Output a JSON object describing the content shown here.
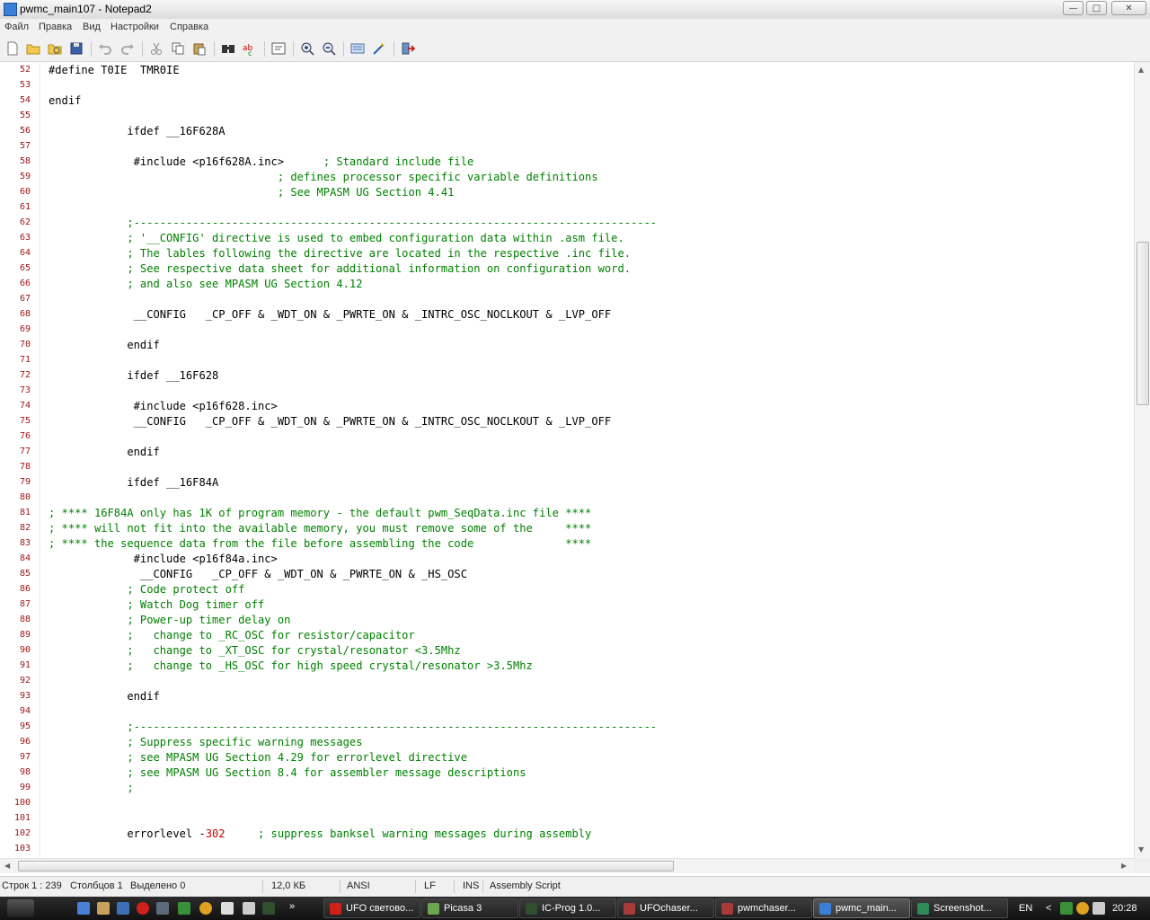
{
  "window": {
    "title": "pwmc_main107 - Notepad2"
  },
  "window_controls": {
    "minimize": "—",
    "maximize": "□",
    "close": "✕"
  },
  "menu": {
    "items": [
      "Файл",
      "Правка",
      "Вид",
      "Настройки",
      "Справка"
    ]
  },
  "toolbar": {
    "icons": [
      "new-file-icon",
      "open-file-icon",
      "browse-icon",
      "save-icon",
      "undo-icon",
      "redo-icon",
      "cut-icon",
      "copy-icon",
      "paste-icon",
      "find-icon",
      "replace-icon",
      "wrap-icon",
      "zoom-in-icon",
      "zoom-out-icon",
      "select-all-icon",
      "settings-icon",
      "exit-icon"
    ]
  },
  "editor": {
    "lines": [
      {
        "n": "52",
        "t": "#define T0IE  TMR0IE",
        "c": ""
      },
      {
        "n": "53",
        "t": "",
        "c": ""
      },
      {
        "n": "54",
        "t": "endif",
        "c": ""
      },
      {
        "n": "55",
        "t": "",
        "c": ""
      },
      {
        "n": "56",
        "t": "            ifdef __16F628A",
        "c": ""
      },
      {
        "n": "57",
        "t": "",
        "c": ""
      },
      {
        "n": "58",
        "t": "             #include <p16f628A.inc>      ",
        "c": "; Standard include file"
      },
      {
        "n": "59",
        "t": "                                   ",
        "c": "; defines processor specific variable definitions"
      },
      {
        "n": "60",
        "t": "                                   ",
        "c": "; See MPASM UG Section 4.41"
      },
      {
        "n": "61",
        "t": "",
        "c": ""
      },
      {
        "n": "62",
        "t": "            ",
        "c": ";--------------------------------------------------------------------------------"
      },
      {
        "n": "63",
        "t": "            ",
        "c": "; '__CONFIG' directive is used to embed configuration data within .asm file."
      },
      {
        "n": "64",
        "t": "            ",
        "c": "; The lables following the directive are located in the respective .inc file."
      },
      {
        "n": "65",
        "t": "            ",
        "c": "; See respective data sheet for additional information on configuration word."
      },
      {
        "n": "66",
        "t": "            ",
        "c": "; and also see MPASM UG Section 4.12"
      },
      {
        "n": "67",
        "t": "",
        "c": ""
      },
      {
        "n": "68",
        "t": "             __CONFIG   _CP_OFF & _WDT_ON & _PWRTE_ON & _INTRC_OSC_NOCLKOUT & _LVP_OFF",
        "c": ""
      },
      {
        "n": "69",
        "t": "",
        "c": ""
      },
      {
        "n": "70",
        "t": "            endif",
        "c": ""
      },
      {
        "n": "71",
        "t": "",
        "c": ""
      },
      {
        "n": "72",
        "t": "            ifdef __16F628",
        "c": ""
      },
      {
        "n": "73",
        "t": "",
        "c": ""
      },
      {
        "n": "74",
        "t": "             #include <p16f628.inc>",
        "c": ""
      },
      {
        "n": "75",
        "t": "             __CONFIG   _CP_OFF & _WDT_ON & _PWRTE_ON & _INTRC_OSC_NOCLKOUT & _LVP_OFF",
        "c": ""
      },
      {
        "n": "76",
        "t": "",
        "c": ""
      },
      {
        "n": "77",
        "t": "            endif",
        "c": ""
      },
      {
        "n": "78",
        "t": "",
        "c": ""
      },
      {
        "n": "79",
        "t": "            ifdef __16F84A",
        "c": ""
      },
      {
        "n": "80",
        "t": "",
        "c": ""
      },
      {
        "n": "81",
        "t": "",
        "c": "; **** 16F84A only has 1K of program memory - the default pwm_SeqData.inc file ****"
      },
      {
        "n": "82",
        "t": "",
        "c": "; **** will not fit into the available memory, you must remove some of the     ****"
      },
      {
        "n": "83",
        "t": "",
        "c": "; **** the sequence data from the file before assembling the code              ****"
      },
      {
        "n": "84",
        "t": "             #include <p16f84a.inc>",
        "c": ""
      },
      {
        "n": "85",
        "t": "              __CONFIG   _CP_OFF & _WDT_ON & _PWRTE_ON & _HS_OSC",
        "c": ""
      },
      {
        "n": "86",
        "t": "            ",
        "c": "; Code protect off"
      },
      {
        "n": "87",
        "t": "            ",
        "c": "; Watch Dog timer off"
      },
      {
        "n": "88",
        "t": "            ",
        "c": "; Power-up timer delay on"
      },
      {
        "n": "89",
        "t": "            ",
        "c": ";   change to _RC_OSC for resistor/capacitor"
      },
      {
        "n": "90",
        "t": "            ",
        "c": ";   change to _XT_OSC for crystal/resonator <3.5Mhz"
      },
      {
        "n": "91",
        "t": "            ",
        "c": ";   change to _HS_OSC for high speed crystal/resonator >3.5Mhz"
      },
      {
        "n": "92",
        "t": "",
        "c": ""
      },
      {
        "n": "93",
        "t": "            endif",
        "c": ""
      },
      {
        "n": "94",
        "t": "",
        "c": ""
      },
      {
        "n": "95",
        "t": "            ",
        "c": ";--------------------------------------------------------------------------------"
      },
      {
        "n": "96",
        "t": "            ",
        "c": "; Suppress specific warning messages"
      },
      {
        "n": "97",
        "t": "            ",
        "c": "; see MPASM UG Section 4.29 for errorlevel directive"
      },
      {
        "n": "98",
        "t": "            ",
        "c": "; see MPASM UG Section 8.4 for assembler message descriptions"
      },
      {
        "n": "99",
        "t": "            ",
        "c": ";"
      },
      {
        "n": "100",
        "t": "",
        "c": ""
      },
      {
        "n": "101",
        "t": "",
        "c": ""
      },
      {
        "n": "102",
        "t": "            errorlevel -302     ",
        "c": "; suppress banksel warning messages during assembly"
      },
      {
        "n": "103",
        "t": "",
        "c": ""
      }
    ]
  },
  "status": {
    "position": "Строк 1 : 239",
    "column": "Столбцов 1",
    "selected": "Выделено 0",
    "size": "12,0 КБ",
    "encoding": "ANSI",
    "line_ending": "LF",
    "mode": "INS",
    "scheme": "Assembly Script"
  },
  "taskbar": {
    "tasks": [
      {
        "label": "UFO светово...",
        "icon_color": "#d0201a"
      },
      {
        "label": "Picasa 3",
        "icon_color": "#6aa84f"
      },
      {
        "label": "IC-Prog 1.0...",
        "icon_color": "#2f4f2f"
      },
      {
        "label": "UFOchaser...",
        "icon_color": "#a83a3a"
      },
      {
        "label": "pwmchaser...",
        "icon_color": "#a83a3a"
      },
      {
        "label": "pwmc_main...",
        "icon_color": "#3b7fd8",
        "active": true
      },
      {
        "label": "Screenshot...",
        "icon_color": "#2e8b57"
      }
    ],
    "tray": {
      "language": "EN",
      "clock": "20:28"
    }
  },
  "colors": {
    "comment": "#008000",
    "line_number": "#a31515",
    "number": "#cc0000",
    "taskbar": "#1c1c1c"
  }
}
